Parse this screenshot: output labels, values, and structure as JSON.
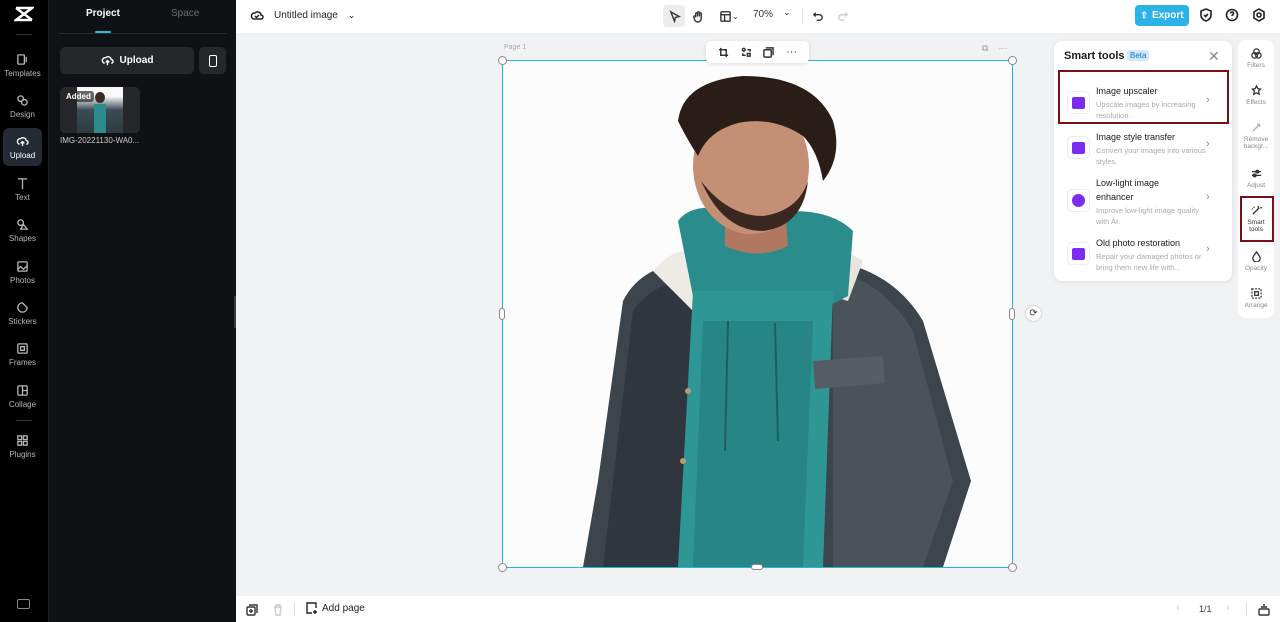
{
  "rail": {
    "logo": "capcut-logo",
    "items": [
      {
        "label": "Templates",
        "icon": "templates-icon"
      },
      {
        "label": "Design",
        "icon": "design-icon"
      },
      {
        "label": "Upload",
        "icon": "upload-cloud-icon",
        "active": true
      },
      {
        "label": "Text",
        "icon": "text-icon"
      },
      {
        "label": "Shapes",
        "icon": "shapes-icon"
      },
      {
        "label": "Photos",
        "icon": "photos-icon"
      },
      {
        "label": "Stickers",
        "icon": "stickers-icon"
      },
      {
        "label": "Frames",
        "icon": "frames-icon"
      },
      {
        "label": "Collage",
        "icon": "collage-icon"
      },
      {
        "label": "Plugins",
        "icon": "plugins-icon"
      }
    ]
  },
  "panel": {
    "tabs": [
      {
        "label": "Project",
        "active": true
      },
      {
        "label": "Space"
      }
    ],
    "upload_label": "Upload",
    "media": [
      {
        "badge": "Added",
        "name": "IMG-20221130-WA0..."
      }
    ]
  },
  "topbar": {
    "title": "Untitled image",
    "zoom": "70%",
    "export_label": "Export"
  },
  "canvas": {
    "page_label": "Page 1"
  },
  "smart_tools": {
    "title": "Smart tools",
    "badge": "Beta",
    "tools": [
      {
        "name": "Image upscaler",
        "desc": "Upscale images by increasing resolution.",
        "highlighted": true
      },
      {
        "name": "Image style transfer",
        "desc": "Convert your images into various styles."
      },
      {
        "name": "Low-light image enhancer",
        "desc": "Improve low-light image quality with AI."
      },
      {
        "name": "Old photo restoration",
        "desc": "Repair your damaged photos or bring them new life with..."
      }
    ]
  },
  "right_panel": {
    "items": [
      {
        "label": "Filters"
      },
      {
        "label": "Effects"
      },
      {
        "label": "Remove backgr..."
      },
      {
        "label": "Adjust"
      },
      {
        "label": "Smart tools",
        "active": true
      },
      {
        "label": "Opacity"
      },
      {
        "label": "Arrange"
      }
    ]
  },
  "bottombar": {
    "add_page_label": "Add page",
    "pager": "1/1"
  },
  "colors": {
    "accent": "#22c2dd",
    "export": "#2bb3e8",
    "highlight": "#7a0f17",
    "tool_icon": "#7b2cf0"
  }
}
